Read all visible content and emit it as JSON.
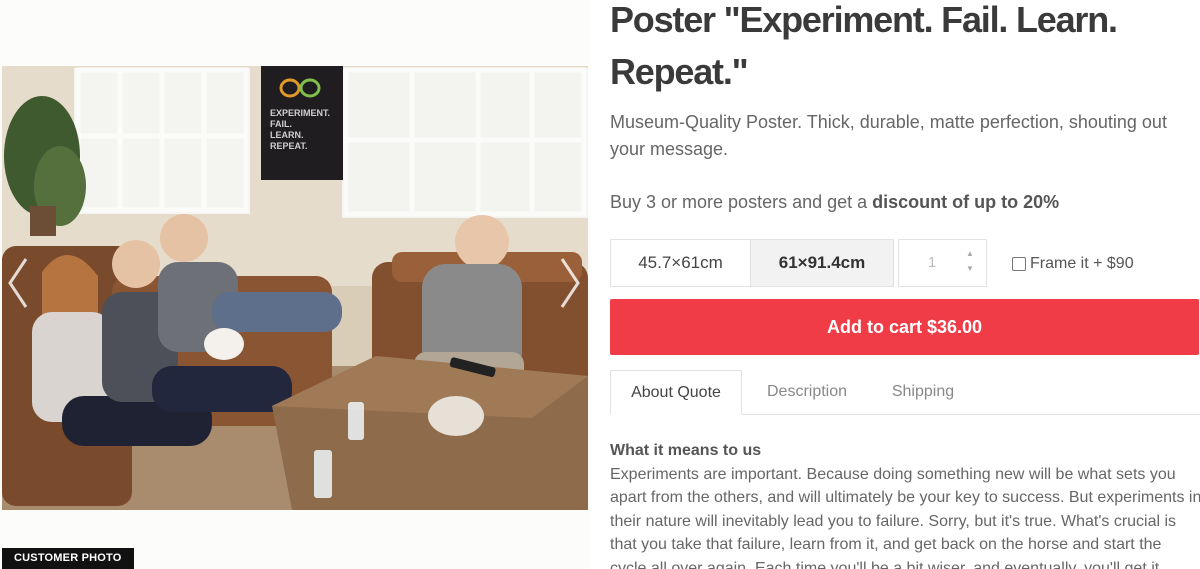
{
  "product": {
    "title": "Poster \"Experiment. Fail. Learn. Repeat.\"",
    "description": "Museum-Quality Poster. Thick, durable, matte perfection, shouting out your message.",
    "promo_prefix": "Buy 3 or more posters and get a ",
    "promo_bold": "discount of up to 20%"
  },
  "gallery": {
    "badge": "CUSTOMER PHOTO",
    "poster_in_photo": [
      "EXPERIMENT.",
      "FAIL.",
      "LEARN.",
      "REPEAT."
    ],
    "left_arrow_icon": "chevron-left-icon",
    "right_arrow_icon": "chevron-right-icon"
  },
  "options": {
    "sizes": [
      "45.7×61cm",
      "61×91.4cm"
    ],
    "selected_size": "61×91.4cm",
    "quantity": "1",
    "frame_label": "Frame it + $90",
    "frame_checked": false
  },
  "cart": {
    "label": "Add to cart $36.00"
  },
  "tabs": {
    "items": [
      "About Quote",
      "Description",
      "Shipping"
    ],
    "active": "About Quote"
  },
  "about": {
    "heading": "What it means to us",
    "body": "Experiments are important. Because doing something new will be what sets you apart from the others, and will ultimately be your key to success. But experiments in their nature will inevitably lead you to failure. Sorry, but it's true. What's crucial is that you take that failure, learn from it, and get back on the horse and start the cycle all over again. Each time you'll be a bit wiser, and eventually, you'll get it."
  },
  "colors": {
    "accent": "#f03c46",
    "title": "#3a3a3a",
    "text": "#666666"
  }
}
